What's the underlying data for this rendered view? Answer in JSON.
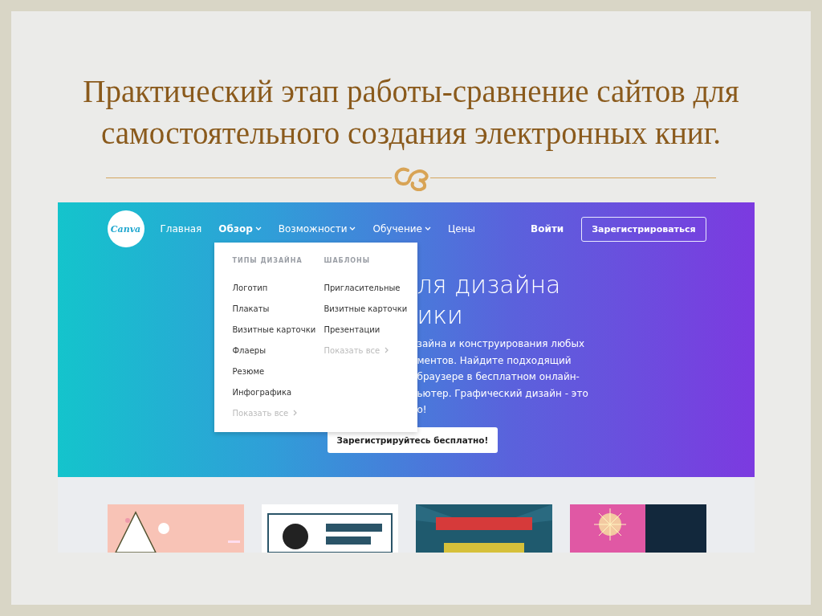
{
  "slide": {
    "title_lines": [
      "Практический этап работы-сравнение сайтов для",
      "самостоятельного создания электронных книг."
    ]
  },
  "site": {
    "logo": "Canva",
    "nav": [
      {
        "label": "Главная",
        "selected": false,
        "dropdown": false
      },
      {
        "label": "Обзор",
        "selected": true,
        "dropdown": true
      },
      {
        "label": "Возможности",
        "selected": false,
        "dropdown": true
      },
      {
        "label": "Обучение",
        "selected": false,
        "dropdown": true
      },
      {
        "label": "Цены",
        "selected": false,
        "dropdown": false
      }
    ],
    "login": "Войти",
    "signup": "Зарегистрироваться",
    "menu": {
      "columns": [
        {
          "heading": "ТИПЫ ДИЗАЙНА",
          "items": [
            "Логотип",
            "Плакаты",
            "Визитные карточки",
            "Флаеры",
            "Резюме",
            "Инфографика"
          ],
          "more": "Показать все"
        },
        {
          "heading": "ШАБЛОНЫ",
          "items": [
            "Пригласительные",
            "Визитные карточки",
            "Презентации"
          ],
          "more": "Показать все"
        }
      ]
    },
    "hero": {
      "heading_lines": [
        "ля дизайна",
        "ики"
      ],
      "text_lines": [
        "зайна и конструирования любых",
        "ментов. Найдите подходящий",
        "браузере в бесплатном онлайн-",
        "ьютер. Графический дизайн - это",
        "о!"
      ],
      "cta": "Зарегистрируйтесь бесплатно!"
    }
  }
}
